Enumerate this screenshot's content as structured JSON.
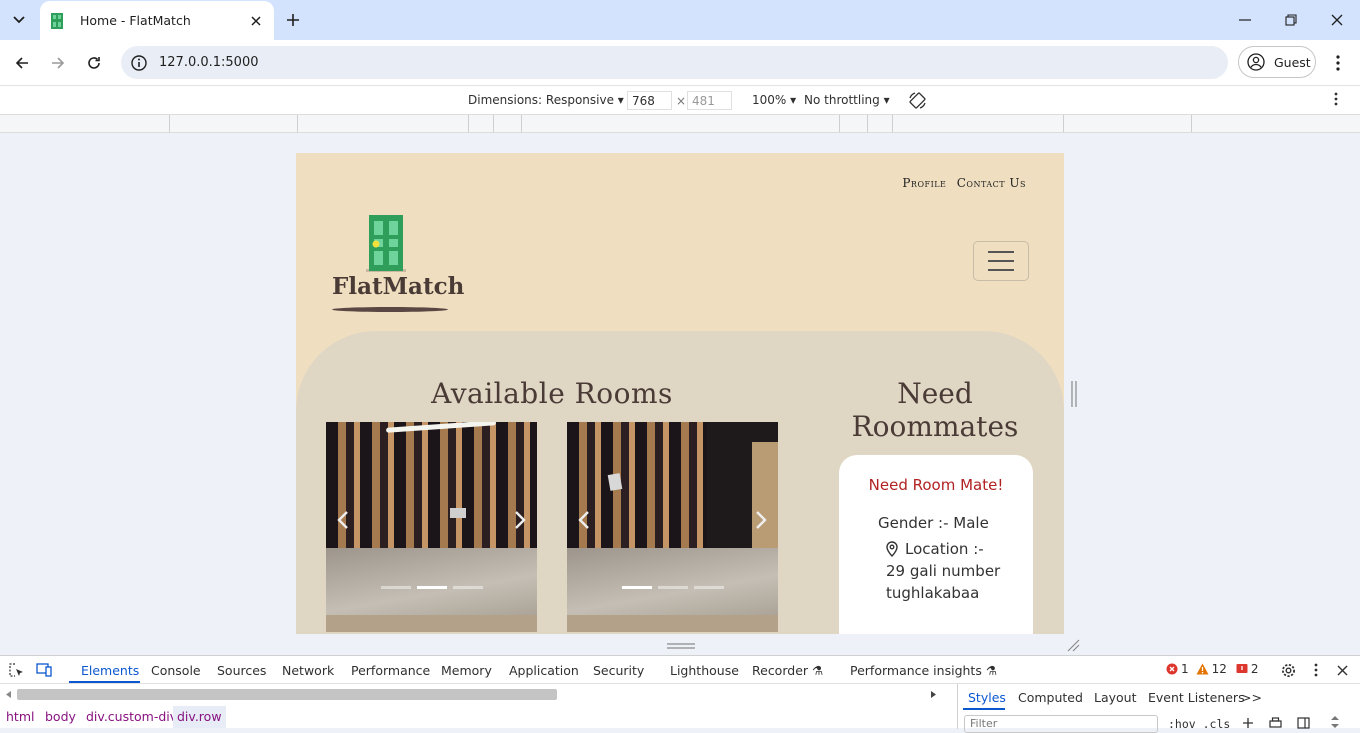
{
  "browser": {
    "tab_title": "Home - FlatMatch",
    "url": "127.0.0.1:5000",
    "profile_label": "Guest"
  },
  "device_toolbar": {
    "dimensions_label": "Dimensions: Responsive",
    "width": "768",
    "height": "481",
    "times": "×",
    "zoom": "100%",
    "throttling": "No throttling"
  },
  "site": {
    "nav": [
      "Profile",
      "Contact Us"
    ],
    "brand": "FlatMatch",
    "available_title": "Available Rooms",
    "need_title": "Need Roommates",
    "card": {
      "title": "Need Room Mate!",
      "gender_label": "Gender :- ",
      "gender_value": "Male",
      "location_label": "Location :-",
      "address": "29 gali number tughlakabaa"
    },
    "carousel_indicators": {
      "count": 3,
      "active_first": 2,
      "active_second": 1
    }
  },
  "devtools": {
    "tabs": [
      "Elements",
      "Console",
      "Sources",
      "Network",
      "Performance",
      "Memory",
      "Application",
      "Security",
      "Lighthouse",
      "Recorder",
      "Performance insights"
    ],
    "active_tab": "Elements",
    "errors": "1",
    "warnings": "12",
    "issues": "2",
    "breadcrumbs": [
      "html",
      "body",
      "div.custom-div",
      "div.row"
    ],
    "styles_tabs": [
      "Styles",
      "Computed",
      "Layout",
      "Event Listeners"
    ],
    "more_tabs": ">>",
    "filter_placeholder": "Filter",
    "hov_cls": ":hov  .cls"
  },
  "colors": {
    "tab_strip": "#d3e3fd",
    "page_bg": "#efdfc0",
    "content_bg": "#e0d6c4",
    "accent_red": "#b22222",
    "devtools_blue": "#0b57d0"
  }
}
